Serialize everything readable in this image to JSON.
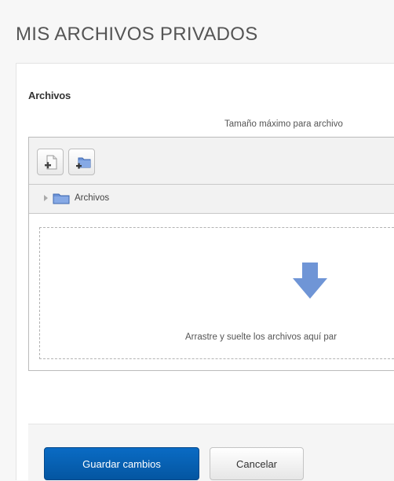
{
  "page": {
    "title": "MIS ARCHIVOS PRIVADOS"
  },
  "form": {
    "section_label": "Archivos",
    "max_size_text": "Tamaño máximo para archivo",
    "toolbar": {
      "add_file_icon": "add-file-icon",
      "create_folder_icon": "create-folder-icon"
    },
    "path": {
      "root_label": "Archivos"
    },
    "dropzone": {
      "text": "Arrastre y suelte los archivos aquí par"
    }
  },
  "buttons": {
    "save_label": "Guardar cambios",
    "cancel_label": "Cancelar"
  },
  "colors": {
    "primary": "#0460b0",
    "drop_arrow": "#6f95d6"
  }
}
